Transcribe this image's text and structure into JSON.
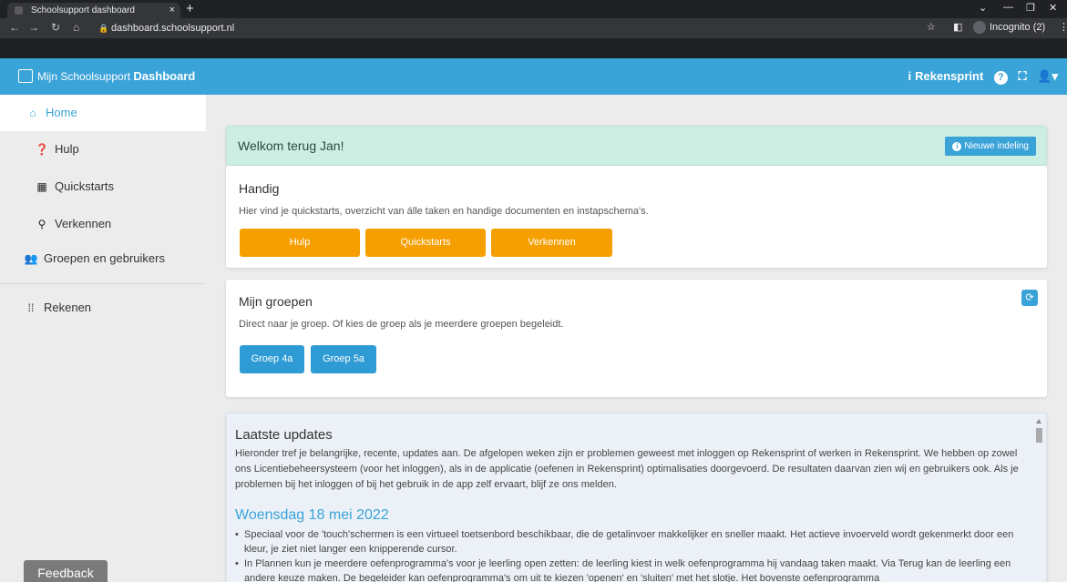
{
  "browser": {
    "tab_title": "Schoolsupport dashboard",
    "tab_close": "×",
    "new_tab": "+",
    "url": "dashboard.schoolsupport.nl",
    "incognito_label": "Incognito (2)"
  },
  "navbar": {
    "brand_prefix": "Mijn Schoolsupport",
    "brand_bold": "Dashboard",
    "app_name": "Rekensprint",
    "info_icon": "i",
    "help_icon": "?",
    "fullscreen_icon": "⛶",
    "user_icon": "👤▾"
  },
  "sidebar": {
    "items": [
      {
        "label": "Home",
        "icon": "⌂"
      },
      {
        "label": "Hulp",
        "icon": "❓"
      },
      {
        "label": "Quickstarts",
        "icon": "▦"
      },
      {
        "label": "Verkennen",
        "icon": "⚲"
      },
      {
        "label": "Groepen en gebruikers",
        "icon": "👥"
      },
      {
        "label": "Rekenen",
        "icon": "⁞⁞"
      }
    ],
    "feedback": "Feedback"
  },
  "welcome": {
    "text": "Welkom terug Jan!",
    "button": "Nieuwe indeling",
    "button_icon": "i"
  },
  "handig": {
    "title": "Handig",
    "description": "Hier vind je quickstarts, overzicht van álle taken en handige documenten en instapschema's.",
    "buttons": [
      "Hulp",
      "Quickstarts",
      "Verkennen"
    ]
  },
  "groepen": {
    "title": "Mijn groepen",
    "description": "Direct naar je groep. Of kies de groep als je meerdere groepen begeleidt.",
    "buttons": [
      "Groep 4a",
      "Groep 5a"
    ],
    "refresh_icon": "⟳"
  },
  "updates": {
    "title": "Laatste updates",
    "intro": "Hieronder tref je belangrijke, recente, updates aan. De afgelopen weken zijn er problemen geweest met inloggen op Rekensprint of werken in Rekensprint. We hebben op zowel ons Licentiebeheersysteem (voor het inloggen), als in de applicatie (oefenen in Rekensprint) optimalisaties doorgevoerd. De resultaten daarvan zien wij en gebruikers ook. Als je problemen bij het inloggen of bij het gebruik in de app zelf ervaart, blijf ze ons melden.",
    "date": "Woensdag 18 mei 2022",
    "items": [
      "Speciaal voor de 'touch'schermen is een virtueel toetsenbord beschikbaar, die de getalinvoer makkelijker en sneller maakt. Het actieve invoerveld wordt gekenmerkt door een kleur, je ziet niet langer een knipperende cursor.",
      "In Plannen kun je meerdere oefenprogramma's voor je leerling open zetten: de leerling kiest in welk oefenprogramma hij vandaag taken maakt. Via Terug kan de leerling een andere keuze maken. De begeleider kan oefenprogramma's om uit te kiezen 'openen' en 'sluiten' met het slotje. Het bovenste oefenprogramma"
    ]
  }
}
